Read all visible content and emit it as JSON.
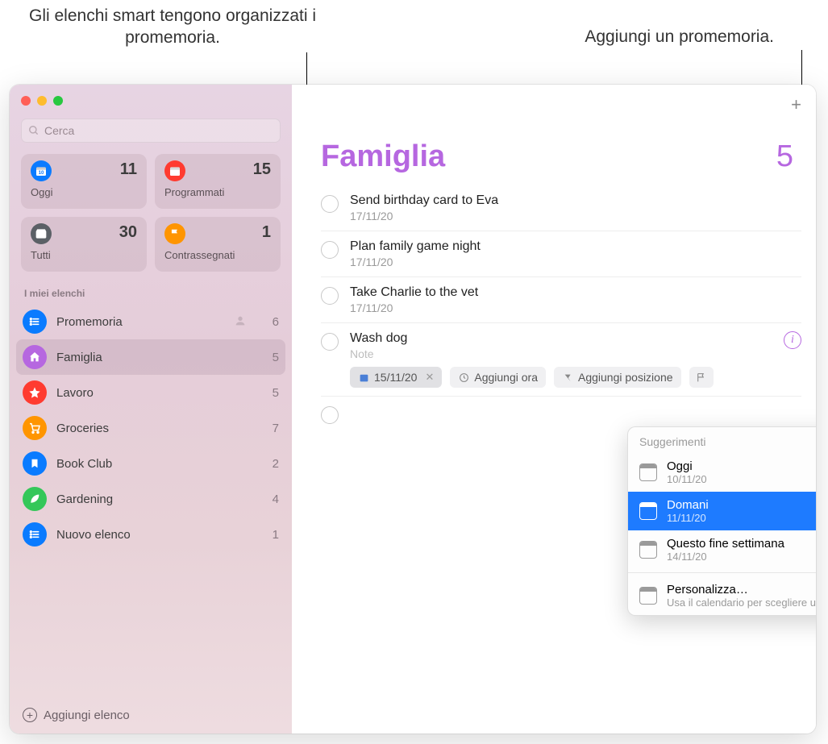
{
  "callouts": {
    "smart_lists": "Gli elenchi smart tengono\norganizzati i promemoria.",
    "add_reminder": "Aggiungi un promemoria."
  },
  "search": {
    "placeholder": "Cerca"
  },
  "smart": [
    {
      "label": "Oggi",
      "count": 11,
      "color": "#0a7bff",
      "icon": "calendar-day"
    },
    {
      "label": "Programmati",
      "count": 15,
      "color": "#ff3b30",
      "icon": "calendar"
    },
    {
      "label": "Tutti",
      "count": 30,
      "color": "#5b6066",
      "icon": "tray"
    },
    {
      "label": "Contrassegnati",
      "count": 1,
      "color": "#ff9500",
      "icon": "flag"
    }
  ],
  "my_lists_header": "I miei elenchi",
  "lists": [
    {
      "label": "Promemoria",
      "count": 6,
      "color": "#0a7bff",
      "icon": "list",
      "shared": true
    },
    {
      "label": "Famiglia",
      "count": 5,
      "color": "#b667e0",
      "icon": "home",
      "active": true
    },
    {
      "label": "Lavoro",
      "count": 5,
      "color": "#ff3b30",
      "icon": "star"
    },
    {
      "label": "Groceries",
      "count": 7,
      "color": "#ff9500",
      "icon": "cart"
    },
    {
      "label": "Book Club",
      "count": 2,
      "color": "#0a7bff",
      "icon": "bookmark"
    },
    {
      "label": "Gardening",
      "count": 4,
      "color": "#34c759",
      "icon": "leaf"
    },
    {
      "label": "Nuovo elenco",
      "count": 1,
      "color": "#0a7bff",
      "icon": "list"
    }
  ],
  "add_list_label": "Aggiungi elenco",
  "main": {
    "title": "Famiglia",
    "count": 5,
    "accent": "#b667e0",
    "reminders": [
      {
        "title": "Send birthday card to Eva",
        "date": "17/11/20"
      },
      {
        "title": "Plan family game night",
        "date": "17/11/20"
      },
      {
        "title": "Take Charlie to the vet",
        "date": "17/11/20"
      },
      {
        "title": "Wash dog",
        "note_placeholder": "Note",
        "editing": true,
        "chips": {
          "date": "15/11/20",
          "time_label": "Aggiungi ora",
          "location_label": "Aggiungi posizione"
        }
      }
    ]
  },
  "suggestions": {
    "header": "Suggerimenti",
    "items": [
      {
        "label": "Oggi",
        "sub": "10/11/20"
      },
      {
        "label": "Domani",
        "sub": "11/11/20",
        "selected": true
      },
      {
        "label": "Questo fine settimana",
        "sub": "14/11/20"
      }
    ],
    "custom": {
      "label": "Personalizza…",
      "sub": "Usa il calendario per scegliere una data"
    }
  }
}
